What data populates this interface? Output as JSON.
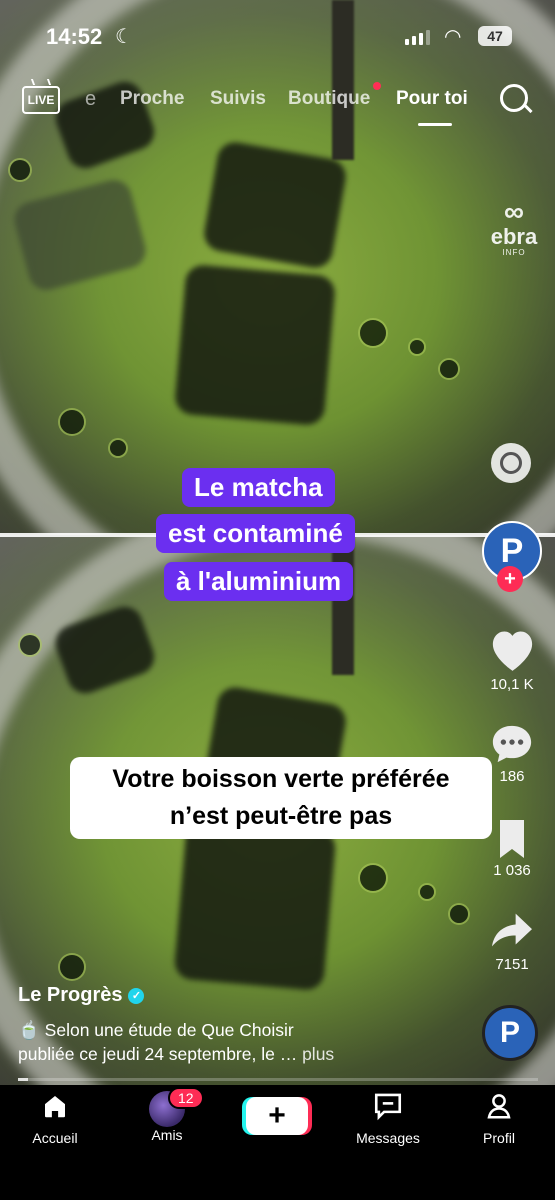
{
  "status_bar": {
    "time": "14:52",
    "battery": "47"
  },
  "top_nav": {
    "live": "LIVE",
    "partial_tab": "e",
    "tabs": [
      "Proche",
      "Suivis",
      "Boutique",
      "Pour toi"
    ],
    "active_tab": "Pour toi"
  },
  "watermark": {
    "logo": "∞",
    "name": "ebra",
    "sub": "INFO"
  },
  "captions": {
    "purple": [
      "Le matcha",
      "est contaminé",
      "à l'aluminium"
    ],
    "white": [
      "Votre boisson verte préférée",
      "n’est peut-être pas"
    ]
  },
  "sidebar": {
    "likes": "10,1 K",
    "comments": "186",
    "saves": "1 036",
    "shares": "7151",
    "avatar_letter": "P"
  },
  "post": {
    "author": "Le Progrès",
    "emoji": "🍵",
    "description_line1": "Selon une étude de Que Choisir",
    "description_line2": "publiée ce jeudi 24 septembre, le …",
    "more": "plus",
    "progress": 0.02
  },
  "bottom_nav": {
    "home": "Accueil",
    "friends": "Amis",
    "friends_badge": "12",
    "create": "+",
    "messages": "Messages",
    "profile": "Profil"
  },
  "colors": {
    "accent_red": "#fe2c55",
    "caption_purple": "#6b2ff0",
    "brand_blue": "#2a63b8"
  }
}
